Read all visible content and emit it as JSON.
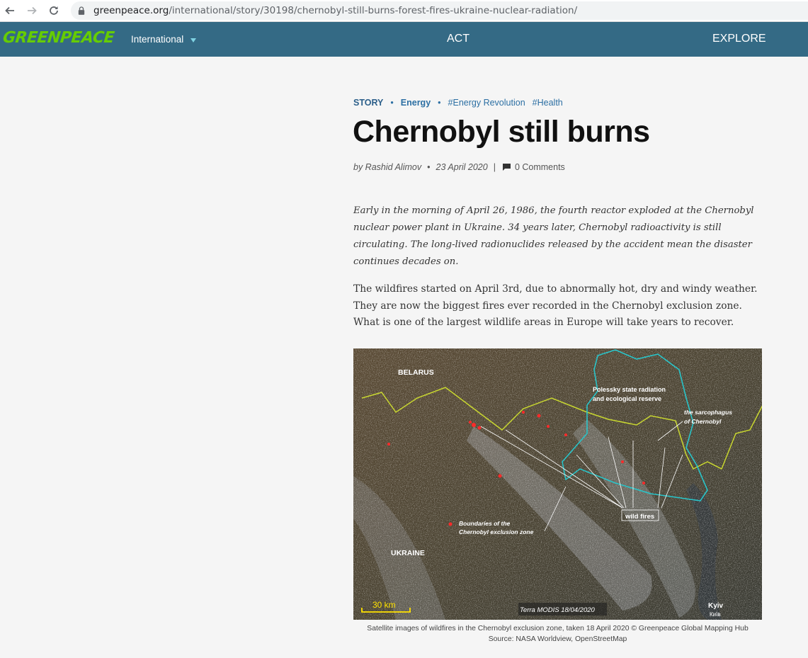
{
  "browser": {
    "url_host": "greenpeace.org",
    "url_path": "/international/story/30198/chernobyl-still-burns-forest-fires-ukraine-nuclear-radiation/"
  },
  "header": {
    "logo": "GREENPEACE",
    "region": "International",
    "nav": [
      "ACT",
      "EXPLORE"
    ]
  },
  "article": {
    "tags": {
      "type": "STORY",
      "category": "Energy",
      "topics": [
        "#Energy Revolution",
        "#Health"
      ]
    },
    "title": "Chernobyl still burns",
    "byline": {
      "author": "by Rashid Alimov",
      "date": "23 April 2020",
      "comments": "0 Comments"
    },
    "lead": "Early in the morning of April 26, 1986, the fourth reactor exploded at the Chernobyl nuclear power plant in Ukraine. 34 years later, Chernobyl radioactivity is still circulating. The long-lived radionuclides released by the accident mean the disaster continues decades on.",
    "paragraph": "The wildfires started on April 3rd, due to abnormally hot, dry and windy weather. They are now the biggest fires ever recorded in the Chernobyl exclusion zone. What is one of the largest wildlife areas in Europe will take years to recover.",
    "figure": {
      "labels": {
        "belarus": "BELARUS",
        "ukraine": "UKRAINE",
        "reserve_line1": "Polessky state radiation",
        "reserve_line2": "and ecological reserve",
        "sarcophagus_line1": "the sarcophagus",
        "sarcophagus_line2": "of Chernobyl",
        "wildfires": "wild fires",
        "boundaries_line1": "Boundaries of the",
        "boundaries_line2": "Chernobyl exclusion zone",
        "scale": "30 km",
        "source": "Terra MODIS 18/04/2020",
        "kyiv": "Kyiv",
        "kyiv_local": "Київ"
      },
      "caption_line1": "Satellite images of wildfires in the Chernobyl exclusion zone, taken 18 April 2020 © Greenpeace Global Mapping Hub",
      "caption_line2": "Source: NASA Worldview, OpenStreetMap"
    }
  },
  "colors": {
    "header_bg": "#346a85",
    "logo": "#66cc00",
    "tag": "#2c6fa3",
    "exclusion_zone": "#29c4c9",
    "border": "#c8d630",
    "fire": "#ff2a2a"
  }
}
